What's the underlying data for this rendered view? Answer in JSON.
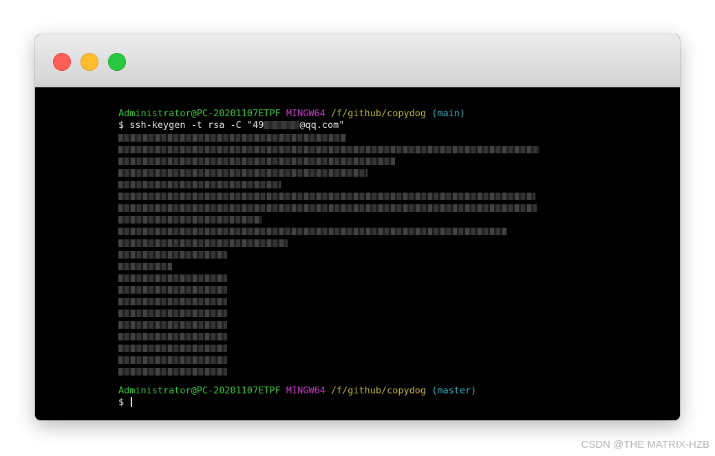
{
  "window": {
    "traffic_lights": [
      {
        "name": "close",
        "color": "#fd5f57"
      },
      {
        "name": "minimize",
        "color": "#febc2e"
      },
      {
        "name": "zoom",
        "color": "#28c840"
      }
    ]
  },
  "terminal": {
    "prompt1": {
      "user_host": "Administrator@PC-20201107ETPF",
      "shell": "MINGW64",
      "path": "/f/github/copydog",
      "branch": "(main)"
    },
    "command": {
      "prefix": "$ ssh-keygen -t rsa -C \"49",
      "suffix": "@qq.com\""
    },
    "prompt2": {
      "user_host": "Administrator@PC-20201107ETPF",
      "shell": "MINGW64",
      "path": "/f/github/copydog",
      "branch": "(master)"
    },
    "final_prompt": "$",
    "colors": {
      "user_host": "#3fc83f",
      "shell": "#c43fc4",
      "path": "#c4b93f",
      "branch": "#3fb4c4"
    }
  },
  "watermark": "CSDN @THE MATRIX-HZB"
}
